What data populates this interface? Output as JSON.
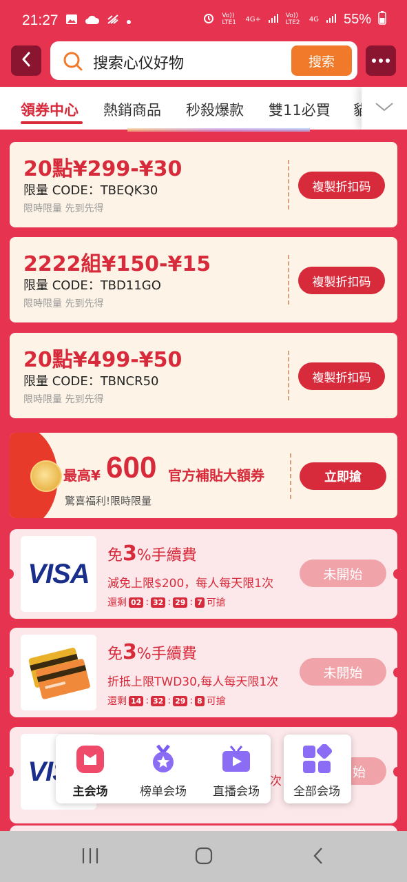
{
  "status_bar": {
    "time": "21:27",
    "signal_labels": [
      "Vo)) LTE1",
      "4G+",
      "Vo)) LTE2",
      "4G"
    ],
    "battery": "55%"
  },
  "header": {
    "search_text": "搜索心仪好物",
    "search_button": "搜索"
  },
  "tabs": [
    {
      "label": "領券中心",
      "active": true
    },
    {
      "label": "熱銷商品",
      "active": false
    },
    {
      "label": "秒殺爆款",
      "active": false
    },
    {
      "label": "雙11必買",
      "active": false
    },
    {
      "label": "貓",
      "active": false
    }
  ],
  "coupons": [
    {
      "title": "20點¥299-¥30",
      "code": "限量 CODE：TBEQK30",
      "note": "限時限量 先到先得",
      "button": "複製折扣码"
    },
    {
      "title": "2222組¥150-¥15",
      "code": "限量 CODE：TBD11GO",
      "note": "限時限量 先到先得",
      "button": "複製折扣码"
    },
    {
      "title": "20點¥499-¥50",
      "code": "限量 CODE：TBNCR50",
      "note": "限時限量 先到先得",
      "button": "複製折扣码"
    }
  ],
  "promo": {
    "prefix": "最高¥",
    "amount": "600",
    "suffix": "官方補貼大額券",
    "subtitle": "驚喜福利!限時限量",
    "button": "立即搶"
  },
  "payment_offers": [
    {
      "brand": "VISA",
      "title_pre": "免",
      "title_num": "3",
      "title_post": "%手續費",
      "desc": "減免上限$200，每人每天限1次",
      "timer_label": "還剩",
      "timer": [
        "02",
        "32",
        "29",
        "7"
      ],
      "timer_suffix": "可搶",
      "button": "未開始"
    },
    {
      "brand": "cards",
      "title_pre": "免",
      "title_num": "3",
      "title_post": "%手續費",
      "desc": "折抵上限TWD30,每人每天限1次",
      "timer_label": "還剩",
      "timer": [
        "14",
        "32",
        "29",
        "8"
      ],
      "timer_suffix": "可搶",
      "button": "未開始"
    },
    {
      "brand": "VISA",
      "desc_tail": "次",
      "button_tail": "始"
    }
  ],
  "float_nav": [
    {
      "label": "主会场",
      "active": true,
      "icon": "tv-home-icon"
    },
    {
      "label": "榜单会场",
      "active": false,
      "icon": "medal-icon"
    },
    {
      "label": "直播会场",
      "active": false,
      "icon": "live-tv-icon"
    },
    {
      "label": "全部会场",
      "active": false,
      "icon": "grid-icon"
    }
  ],
  "colors": {
    "accent": "#d72a3a",
    "page_bg": "#e63450",
    "coupon_bg": "#fdf3e6",
    "pay_bg": "#fce8ea",
    "search_button": "#f07a2a"
  }
}
